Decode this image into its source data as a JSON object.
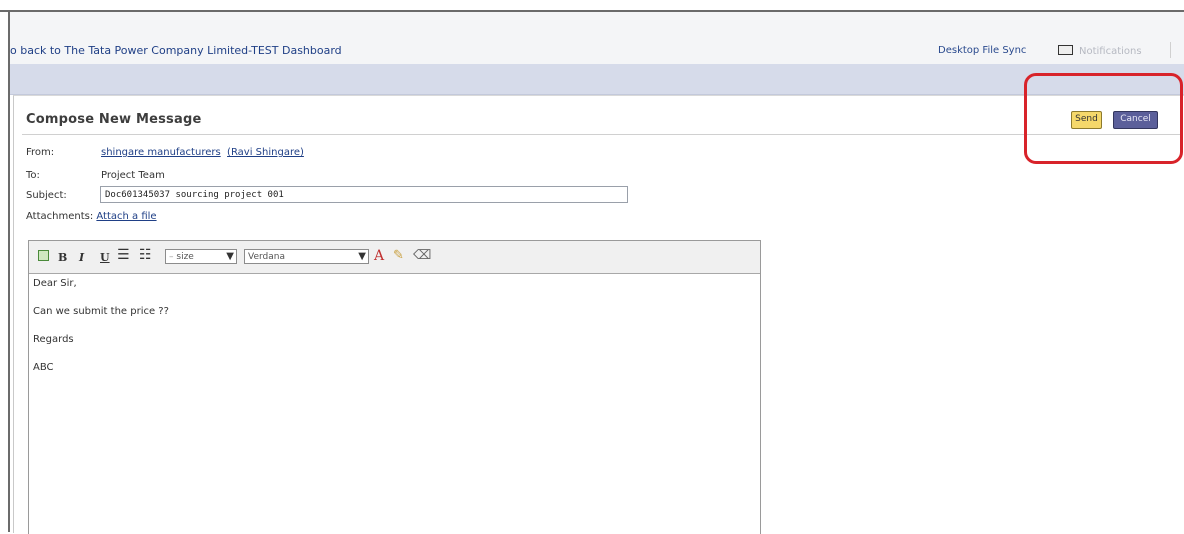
{
  "topbar": {
    "back_prefix": "o back to ",
    "back_target": "The Tata Power Company Limited-TEST Dashboard",
    "desktop_sync": "Desktop File Sync",
    "notifications": "Notifications"
  },
  "compose": {
    "title": "Compose New Message",
    "send_label": "Send",
    "cancel_label": "Cancel",
    "from_label": "From:",
    "from_company": "shingare manufacturers",
    "from_person": "(Ravi Shingare)",
    "to_label": "To:",
    "to_value": "Project Team",
    "subject_label": "Subject:",
    "subject_value": "Doc601345037  sourcing project 001",
    "attachments_label": "Attachments:",
    "attach_link": "Attach a file"
  },
  "toolbar": {
    "bold": "B",
    "italic": "I",
    "underline": "U",
    "size_value": "size",
    "font_value": "Verdana",
    "icons": [
      "html-source-icon",
      "bold-icon",
      "italic-icon",
      "underline-icon",
      "ordered-list-icon",
      "unordered-list-icon",
      "text-color-icon",
      "highlight-icon",
      "eraser-icon"
    ]
  },
  "body": {
    "lines": [
      "Dear Sir,",
      "Can we submit the price ??",
      "Regards",
      "ABC"
    ]
  },
  "colors": {
    "link": "#1f3f86",
    "send_bg": "#f5d86a",
    "cancel_bg": "#5b5f9a",
    "highlight_circle": "#d8232a",
    "header_band": "#d6dbea"
  }
}
